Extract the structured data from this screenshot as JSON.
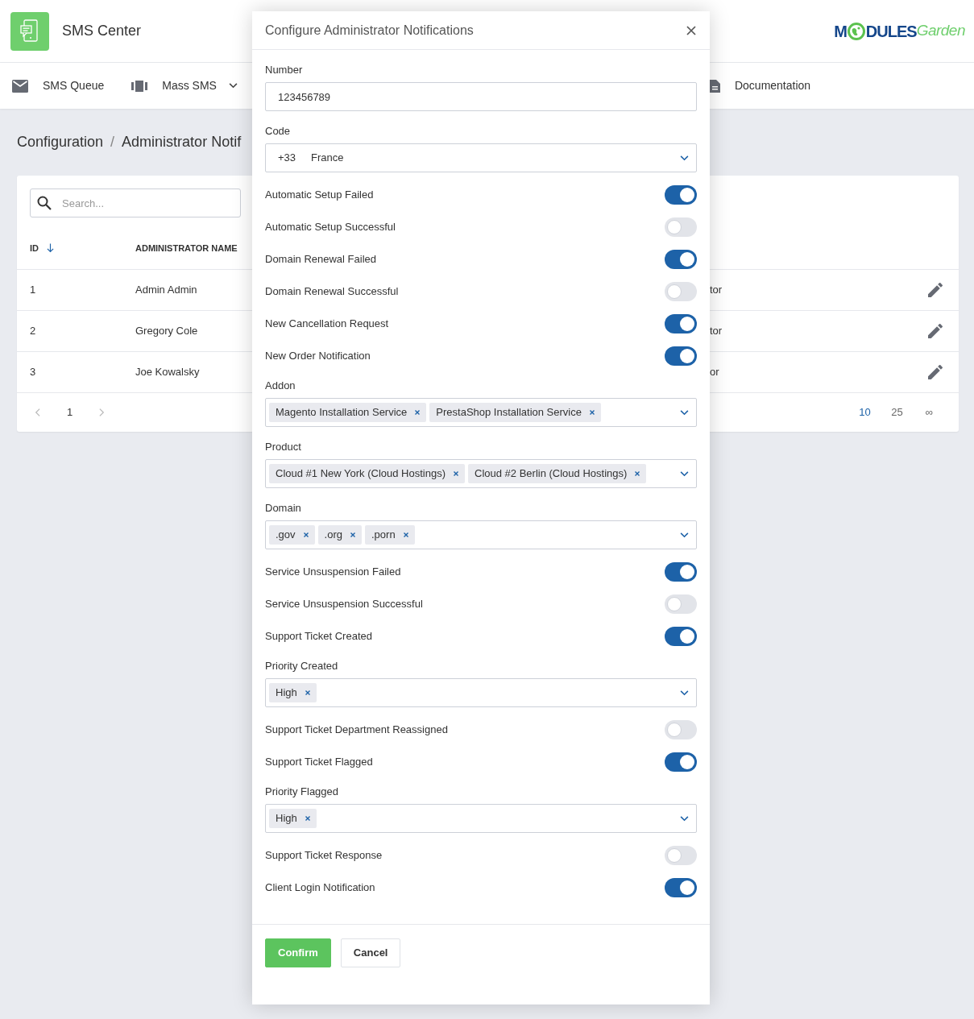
{
  "header": {
    "app_title": "SMS Center",
    "logo": {
      "lead": "M",
      "tail": "DULES",
      "suffix": "Garden"
    }
  },
  "nav": [
    {
      "label": "SMS Queue",
      "kind": "envelope",
      "dropdown": false
    },
    {
      "label": "Mass SMS",
      "kind": "bars",
      "dropdown": true
    },
    {
      "label": "Documentation",
      "kind": "document",
      "dropdown": false
    }
  ],
  "breadcrumb": {
    "items": [
      "Configuration",
      "Administrator Notif"
    ],
    "separator": "/"
  },
  "search": {
    "placeholder": "Search..."
  },
  "table": {
    "columns": [
      "ID",
      "ADMINISTRATOR NAME"
    ],
    "rows": [
      {
        "id": "1",
        "name": "Admin Admin",
        "column_3": "tor"
      },
      {
        "id": "2",
        "name": "Gregory Cole",
        "column_3": "tor"
      },
      {
        "id": "3",
        "name": "Joe Kowalsky",
        "column_3": "or"
      }
    ],
    "pages": [
      {
        "label": "1",
        "selected": true
      }
    ],
    "page_sizes": [
      {
        "label": "10",
        "selected": true
      },
      {
        "label": "25",
        "selected": false
      },
      {
        "label": "∞",
        "selected": false
      }
    ]
  },
  "modal": {
    "title": "Configure Administrator Notifications",
    "fields": [
      {
        "kind": "text",
        "label": "Number",
        "value": "123456789"
      },
      {
        "kind": "select",
        "label": "Code",
        "prefix": "+33",
        "value": "France"
      },
      {
        "kind": "toggle",
        "label": "Automatic Setup Failed",
        "on": true
      },
      {
        "kind": "toggle",
        "label": "Automatic Setup Successful",
        "on": false
      },
      {
        "kind": "toggle",
        "label": "Domain Renewal Failed",
        "on": true
      },
      {
        "kind": "toggle",
        "label": "Domain Renewal Successful",
        "on": false
      },
      {
        "kind": "toggle",
        "label": "New Cancellation Request",
        "on": true
      },
      {
        "kind": "toggle",
        "label": "New Order Notification",
        "on": true
      },
      {
        "kind": "multiselect",
        "label": "Addon",
        "chips": [
          "Magento Installation Service",
          "PrestaShop Installation Service"
        ]
      },
      {
        "kind": "multiselect",
        "label": "Product",
        "chips": [
          "Cloud #1 New York (Cloud Hostings)",
          "Cloud #2 Berlin (Cloud Hostings)"
        ]
      },
      {
        "kind": "multiselect",
        "label": "Domain",
        "chips": [
          ".gov",
          ".org",
          ".porn"
        ]
      },
      {
        "kind": "toggle",
        "label": "Service Unsuspension Failed",
        "on": true
      },
      {
        "kind": "toggle",
        "label": "Service Unsuspension Successful",
        "on": false
      },
      {
        "kind": "toggle",
        "label": "Support Ticket Created",
        "on": true
      },
      {
        "kind": "multiselect",
        "label": "Priority Created",
        "chips": [
          "High"
        ]
      },
      {
        "kind": "toggle",
        "label": "Support Ticket Department Reassigned",
        "on": false
      },
      {
        "kind": "toggle",
        "label": "Support Ticket Flagged",
        "on": true
      },
      {
        "kind": "multiselect",
        "label": "Priority Flagged",
        "chips": [
          "High"
        ]
      },
      {
        "kind": "toggle",
        "label": "Support Ticket Response",
        "on": false
      },
      {
        "kind": "toggle",
        "label": "Client Login Notification",
        "on": true
      }
    ],
    "buttons": [
      {
        "label": "Confirm",
        "kind": "primary"
      },
      {
        "label": "Cancel",
        "kind": "secondary"
      }
    ]
  }
}
